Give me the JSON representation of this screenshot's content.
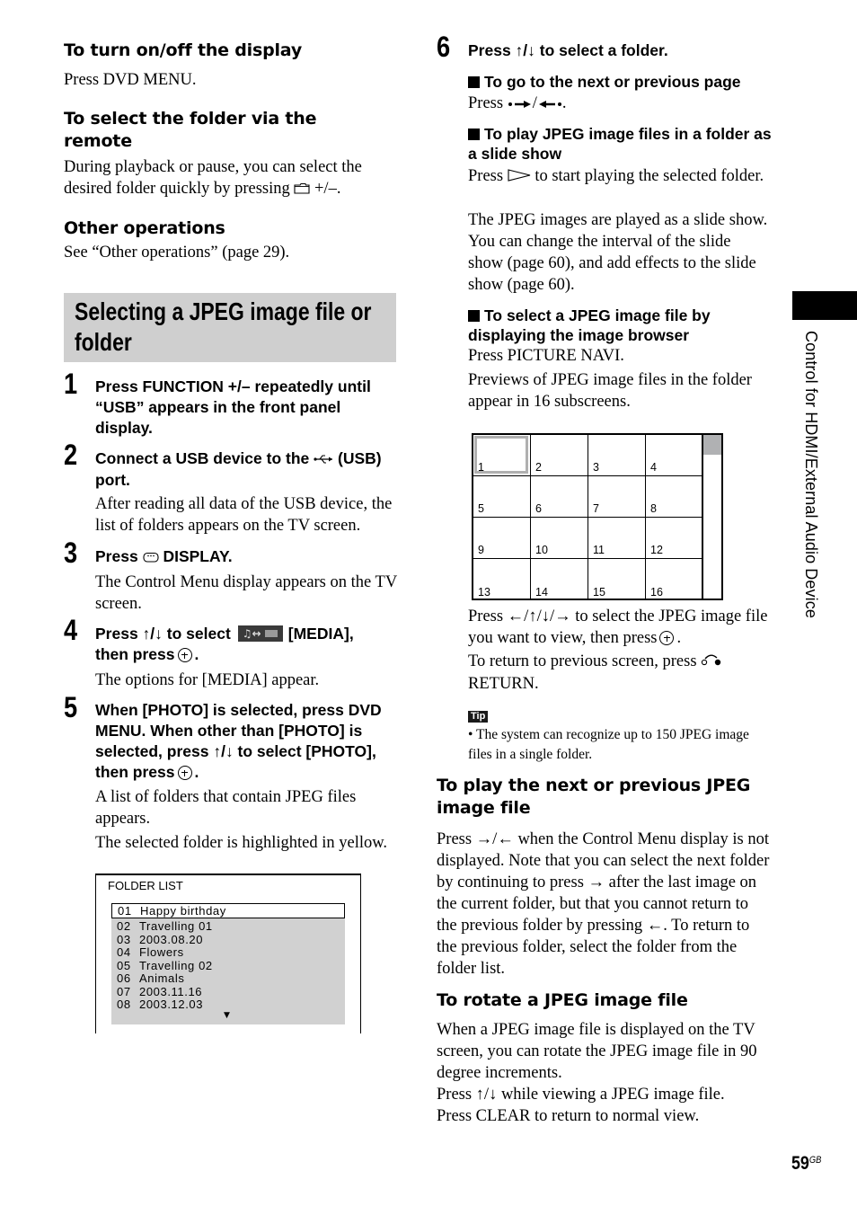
{
  "left": {
    "h_display": "To turn on/off the display",
    "p_display": "Press DVD MENU.",
    "h_folder_remote": "To select the folder via the remote",
    "p_folder_remote_a": "During playback or pause, you can select the desired folder quickly by pressing",
    "p_folder_remote_b": "+/–.",
    "h_other": "Other operations",
    "p_other": "See “Other operations” (page 29).",
    "section_title": "Selecting a JPEG image file or folder",
    "steps": [
      {
        "num": "1",
        "title": "Press FUNCTION +/– repeatedly until “USB” appears in the front panel display."
      },
      {
        "num": "2",
        "title_a": "Connect a USB device to the",
        "title_b": "(USB) port.",
        "body": "After reading all data of the USB device, the list of folders appears on the TV screen."
      },
      {
        "num": "3",
        "title_a": "Press",
        "title_b": "DISPLAY.",
        "body": "The Control Menu display appears on the TV screen."
      },
      {
        "num": "4",
        "title_a": "Press ↑/↓ to select",
        "title_b": "[MEDIA],",
        "title_c": "then press",
        "body": "The options for [MEDIA] appear."
      },
      {
        "num": "5",
        "title_a": "When [PHOTO] is selected, press DVD MENU. When other than [PHOTO] is selected, press ↑/↓ to select [PHOTO],",
        "title_c": "then press",
        "body_1": "A list of folders that contain JPEG files appears.",
        "body_2": "The selected folder is highlighted in yellow."
      }
    ],
    "folder_list": {
      "title": "FOLDER LIST",
      "items": [
        {
          "num": "01",
          "name": "Happy birthday",
          "selected": true
        },
        {
          "num": "02",
          "name": "Travelling 01"
        },
        {
          "num": "03",
          "name": "2003.08.20"
        },
        {
          "num": "04",
          "name": "Flowers"
        },
        {
          "num": "05",
          "name": "Travelling 02"
        },
        {
          "num": "06",
          "name": "Animals"
        },
        {
          "num": "07",
          "name": "2003.11.16"
        },
        {
          "num": "08",
          "name": "2003.12.03"
        }
      ],
      "more_indicator": "▼"
    }
  },
  "right": {
    "step6": {
      "num": "6",
      "title": "Press ↑/↓ to select a folder."
    },
    "sub_page_title": "To go to the next or previous page",
    "sub_page_body_a": "Press",
    "sub_page_body_b": "/",
    "sub_page_body_c": ".",
    "sub_slide_title": "To play JPEG image files in a folder as a slide show",
    "sub_slide_body_a": "Press",
    "sub_slide_body_b": "to start playing the selected folder.",
    "sub_slide_body_2": "The JPEG images are played as a slide show. You can change the interval of the slide show (page 60), and add effects to the slide show (page 60).",
    "sub_browser_title": "To select a JPEG image file by displaying the image browser",
    "sub_browser_body_1": "Press PICTURE NAVI.",
    "sub_browser_body_2": "Previews of JPEG image files in the folder appear in 16 subscreens.",
    "browser_cells": [
      "1",
      "2",
      "3",
      "4",
      "5",
      "6",
      "7",
      "8",
      "9",
      "10",
      "11",
      "12",
      "13",
      "14",
      "15",
      "16"
    ],
    "browser_selected": "1",
    "after_browser_a": "Press ←/↑/↓/→ to select the JPEG image file you want to view, then press",
    "after_browser_b": ".",
    "after_browser_2a": "To return to previous screen, press",
    "after_browser_2b": "RETURN.",
    "tip_label": "Tip",
    "tip_text": "• The system can recognize up to 150 JPEG image files in a single folder.",
    "h_next_prev": "To play the next or previous JPEG image file",
    "p_next_prev": "Press →/← when the Control Menu display is not displayed. Note that you can select the next folder by continuing to press → after the last image on the current folder, but that you cannot return to the previous folder by pressing ←. To return to the previous folder, select the folder from the folder list.",
    "h_rotate": "To rotate a JPEG image file",
    "p_rotate_1": "When a JPEG image file is displayed on the TV screen, you can rotate the JPEG image file in 90 degree increments.",
    "p_rotate_2": "Press ↑/↓ while viewing a JPEG image file.",
    "p_rotate_3": "Press CLEAR to return to normal view."
  },
  "side_tab": "Control for HDMI/External Audio Device",
  "page_number": "59",
  "page_suffix": "GB"
}
